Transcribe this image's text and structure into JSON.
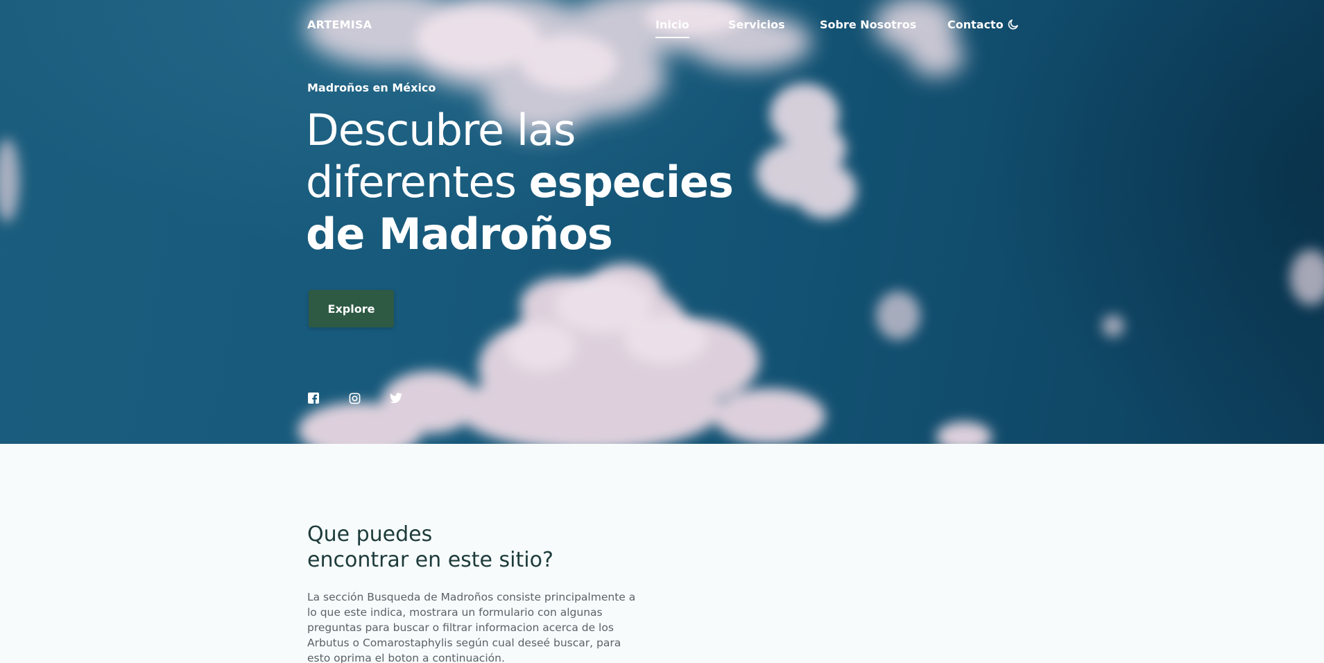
{
  "header": {
    "brand": "ARTEMISA",
    "nav": [
      {
        "label": "Inicio",
        "active": true
      },
      {
        "label": "Servicios",
        "active": false
      },
      {
        "label": "Sobre Nosotros",
        "active": false
      },
      {
        "label": "Contacto",
        "active": false
      }
    ],
    "theme_toggle_icon": "moon-icon"
  },
  "hero": {
    "subtitle": "Madroños en México",
    "title_line1": "Descubre las",
    "title_line2_light": "diferentes ",
    "title_line2_bold": "especies",
    "title_line3_bold": "de Madroños",
    "cta_label": "Explore",
    "social_icons": [
      "facebook-icon",
      "instagram-icon",
      "twitter-icon"
    ]
  },
  "section": {
    "title_line1": "Que puedes",
    "title_line2": "encontrar en este sitio?",
    "body": "La sección Busqueda de Madroños consiste principalmente a lo que este indica, mostrara un formulario con algunas preguntas para buscar o filtrar informacion acerca de los Arbutus o Comarostaphylis según cual deseé buscar, para esto oprima el boton a continuación."
  },
  "colors": {
    "sky_blue": "#17597b",
    "cta_green": "#2e5a44",
    "heading_dark": "#1d3b3a",
    "body_text": "#5a6166",
    "section_bg": "#f7fbfc"
  }
}
